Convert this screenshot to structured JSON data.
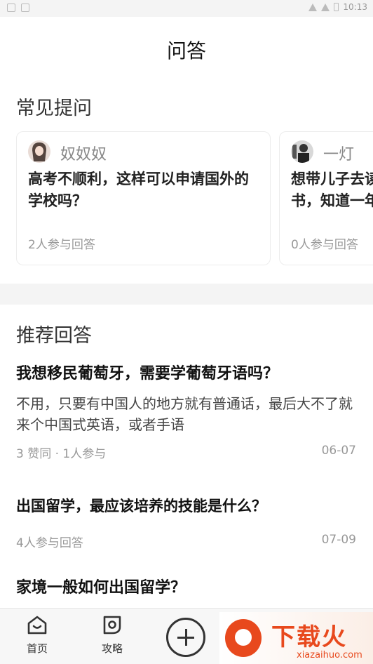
{
  "status_bar": {
    "time": "10:13"
  },
  "page": {
    "title": "问答"
  },
  "faq": {
    "heading": "常见提问",
    "cards": [
      {
        "author": "奴奴奴",
        "question": "高考不顺利，这样可以申请国外的学校吗？",
        "meta": "2人参与回答"
      },
      {
        "author": "一灯",
        "question": "想带儿子去读书，知道一年生活费",
        "meta": "0人参与回答"
      }
    ]
  },
  "recommended": {
    "heading": "推荐回答",
    "items": [
      {
        "question": "我想移民葡萄牙，需要学葡萄牙语吗？",
        "answer": "不用，只要有中国人的地方就有普通话，最后大不了就来个中国式英语，或者手语",
        "meta": "3 赞同 · 1人参与",
        "date": "06-07"
      },
      {
        "question": "出国留学，最应该培养的技能是什么？",
        "meta": "4人参与回答",
        "date": "07-09"
      },
      {
        "question": "家境一般如何出国留学？"
      }
    ]
  },
  "tabbar": {
    "tabs": [
      {
        "label": "首页",
        "icon": "home-icon"
      },
      {
        "label": "攻略",
        "icon": "guide-icon"
      },
      {
        "label": "",
        "icon": "add-icon"
      }
    ]
  },
  "watermark": {
    "text": "下载火",
    "url": "xiazaihuo.com"
  }
}
